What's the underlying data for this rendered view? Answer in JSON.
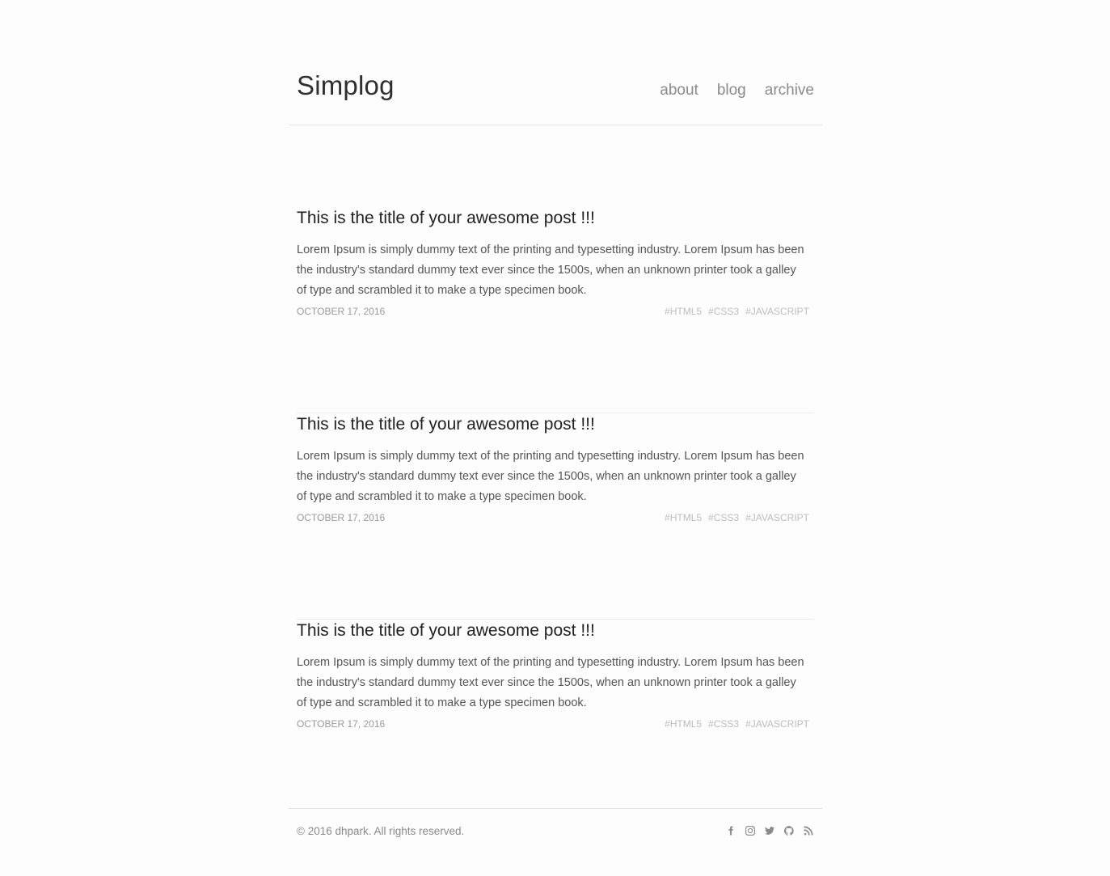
{
  "site": {
    "title": "Simplog"
  },
  "nav": {
    "items": [
      {
        "label": "about"
      },
      {
        "label": "blog"
      },
      {
        "label": "archive"
      }
    ]
  },
  "posts": [
    {
      "title": "This is the title of your awesome post !!!",
      "excerpt": "Lorem Ipsum is simply dummy text of the printing and typesetting industry. Lorem Ipsum has been the industry's standard dummy text ever since the 1500s, when an unknown printer took a galley of type and scrambled it to make a type specimen book.",
      "date": "OCTOBER 17, 2016",
      "tags": [
        "#HTML5",
        "#CSS3",
        "#JAVASCRIPT"
      ]
    },
    {
      "title": "This is the title of your awesome post !!!",
      "excerpt": "Lorem Ipsum is simply dummy text of the printing and typesetting industry. Lorem Ipsum has been the industry's standard dummy text ever since the 1500s, when an unknown printer took a galley of type and scrambled it to make a type specimen book.",
      "date": "OCTOBER 17, 2016",
      "tags": [
        "#HTML5",
        "#CSS3",
        "#JAVASCRIPT"
      ]
    },
    {
      "title": "This is the title of your awesome post !!!",
      "excerpt": "Lorem Ipsum is simply dummy text of the printing and typesetting industry. Lorem Ipsum has been the industry's standard dummy text ever since the 1500s, when an unknown printer took a galley of type and scrambled it to make a type specimen book.",
      "date": "OCTOBER 17, 2016",
      "tags": [
        "#HTML5",
        "#CSS3",
        "#JAVASCRIPT"
      ]
    }
  ],
  "footer": {
    "copyright": "© 2016 dhpark. All rights reserved.",
    "social_icons": [
      "facebook-icon",
      "instagram-icon",
      "twitter-icon",
      "github-icon",
      "rss-icon"
    ]
  },
  "colors": {
    "background": "#fdfdfd",
    "title": "#2f2f2f",
    "nav": "#8a8a8a",
    "body_text": "#555555",
    "meta": "#9a9a9a",
    "tags": "#bdbdbd",
    "divider": "#e3e3e3"
  }
}
